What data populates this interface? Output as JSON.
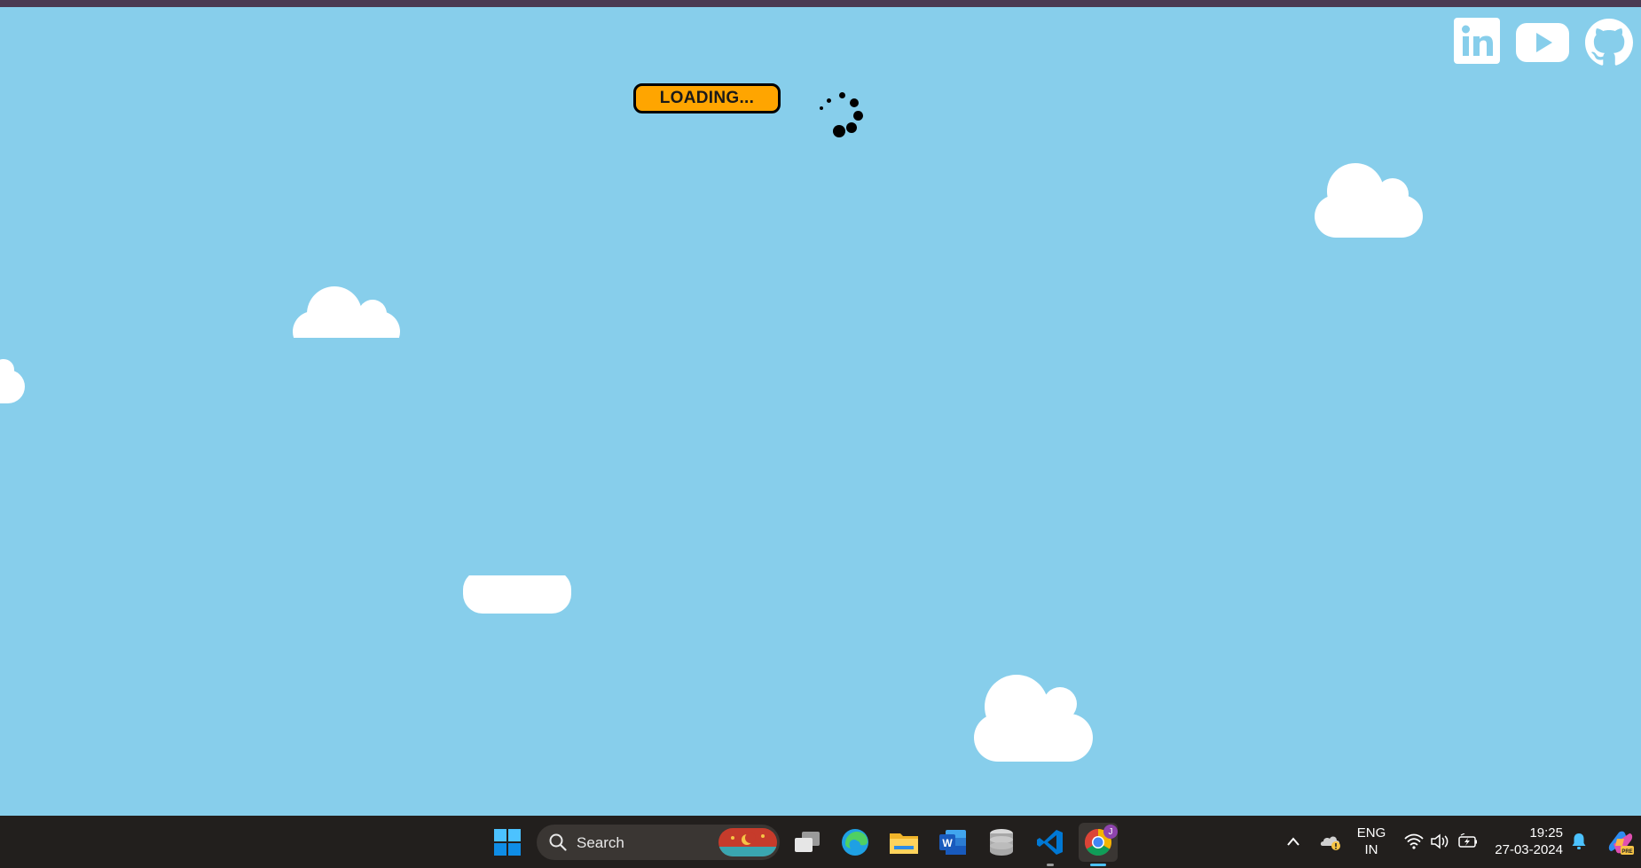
{
  "game": {
    "loading_label": "LOADING...",
    "sky_color": "#87ceeb",
    "button_color": "#ffa500"
  },
  "social_links": [
    {
      "name": "linkedin-icon"
    },
    {
      "name": "youtube-icon"
    },
    {
      "name": "github-icon"
    }
  ],
  "taskbar": {
    "search_placeholder": "Search",
    "pinned_apps": [
      "start-icon",
      "task-view-icon",
      "edge-icon",
      "file-explorer-icon",
      "word-icon",
      "database-icon",
      "vscode-icon",
      "chrome-icon"
    ],
    "chrome_badge": "J",
    "language_line1": "ENG",
    "language_line2": "IN",
    "time": "19:25",
    "date": "27-03-2024"
  }
}
